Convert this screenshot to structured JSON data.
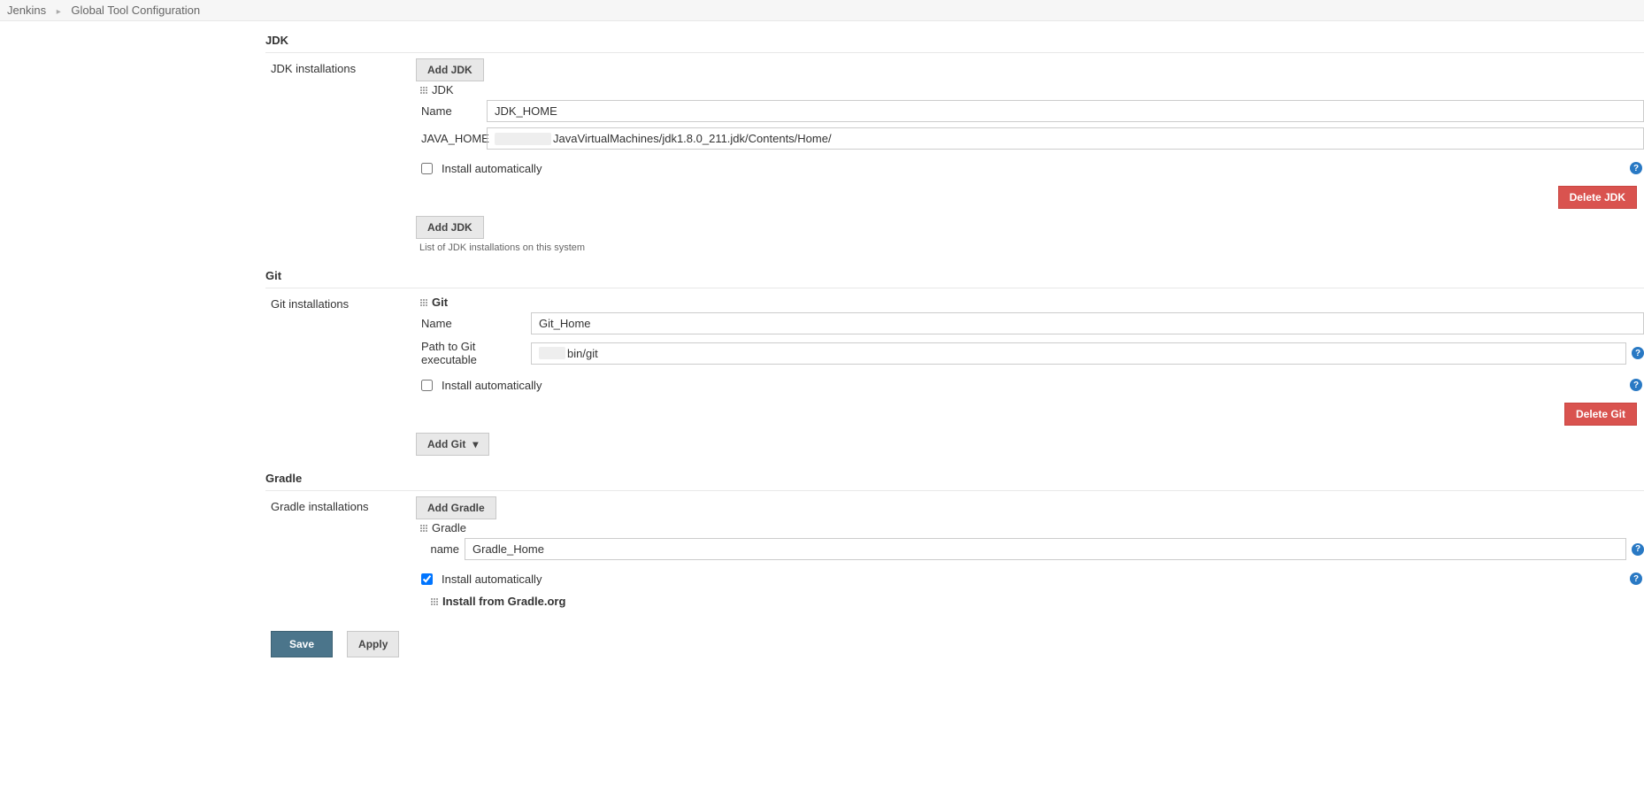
{
  "breadcrumbs": {
    "root": "Jenkins",
    "page": "Global Tool Configuration"
  },
  "jdk": {
    "section_title": "JDK",
    "installations_label": "JDK installations",
    "add_button": "Add JDK",
    "add_button_bottom": "Add JDK",
    "entry_title": "JDK",
    "name_label": "Name",
    "name_value": "JDK_HOME",
    "home_label": "JAVA_HOME",
    "home_value": "JavaVirtualMachines/jdk1.8.0_211.jdk/Contents/Home/",
    "install_auto_label": "Install automatically",
    "install_auto_checked": false,
    "delete_button": "Delete JDK",
    "footer_text": "List of JDK installations on this system"
  },
  "git": {
    "section_title": "Git",
    "installations_label": "Git installations",
    "entry_title": "Git",
    "name_label": "Name",
    "name_value": "Git_Home",
    "path_label": "Path to Git executable",
    "path_value": "bin/git",
    "install_auto_label": "Install automatically",
    "install_auto_checked": false,
    "delete_button": "Delete Git",
    "add_button": "Add Git"
  },
  "gradle": {
    "section_title": "Gradle",
    "installations_label": "Gradle installations",
    "add_button": "Add Gradle",
    "entry_title": "Gradle",
    "name_label": "name",
    "name_value": "Gradle_Home",
    "install_auto_label": "Install automatically",
    "install_auto_checked": true,
    "installer_title": "Install from Gradle.org"
  },
  "actions": {
    "save": "Save",
    "apply": "Apply"
  }
}
